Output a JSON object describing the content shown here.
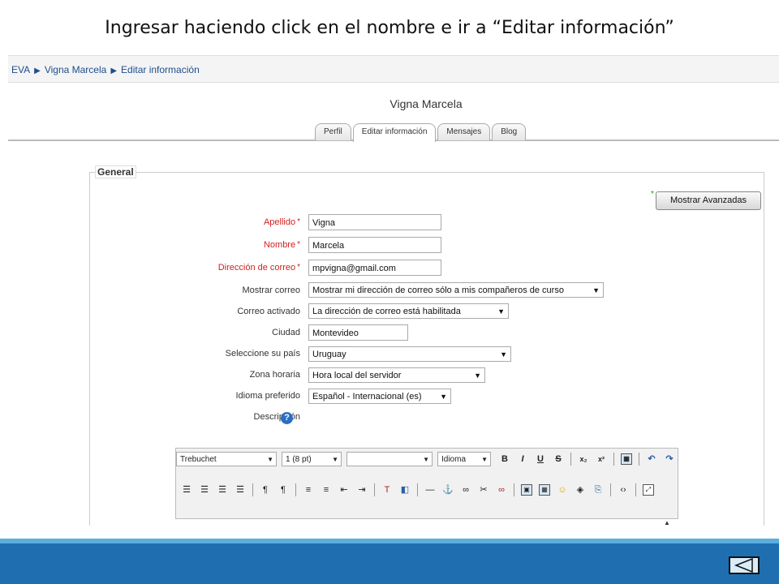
{
  "slide": {
    "title": "Ingresar haciendo click en el nombre e ir a “Editar información”"
  },
  "breadcrumb": {
    "items": [
      "EVA",
      "Vigna Marcela",
      "Editar información"
    ]
  },
  "profile": {
    "name": "Vigna Marcela"
  },
  "tabs": [
    {
      "label": "Perfil"
    },
    {
      "label": "Editar información"
    },
    {
      "label": "Mensajes"
    },
    {
      "label": "Blog"
    }
  ],
  "form": {
    "legend": "General",
    "advanced_button": "Mostrar Avanzadas",
    "required_mark": "*",
    "fields": {
      "apellido": {
        "label": "Apellido",
        "value": "Vigna"
      },
      "nombre": {
        "label": "Nombre",
        "value": "Marcela"
      },
      "email": {
        "label": "Dirección de correo",
        "value": "mpvigna@gmail.com"
      },
      "mostrar_correo": {
        "label": "Mostrar correo",
        "value": "Mostrar mi dirección de correo sólo a mis compañeros de curso"
      },
      "correo_activado": {
        "label": "Correo activado",
        "value": "La dirección de correo está habilitada"
      },
      "ciudad": {
        "label": "Ciudad",
        "value": "Montevideo"
      },
      "pais": {
        "label": "Seleccione su país",
        "value": "Uruguay"
      },
      "zona": {
        "label": "Zona horaria",
        "value": "Hora local del servidor"
      },
      "idioma": {
        "label": "Idioma preferido",
        "value": "Español - Internacional (es)"
      },
      "descripcion": {
        "label": "Descripción"
      }
    }
  },
  "editor": {
    "font": "Trebuchet",
    "size": "1 (8 pt)",
    "format": "",
    "language": "Idioma"
  },
  "colors": {
    "bottom_bar": "#1f6fb0",
    "link": "#1f4e8c",
    "required": "#d21f1f"
  }
}
